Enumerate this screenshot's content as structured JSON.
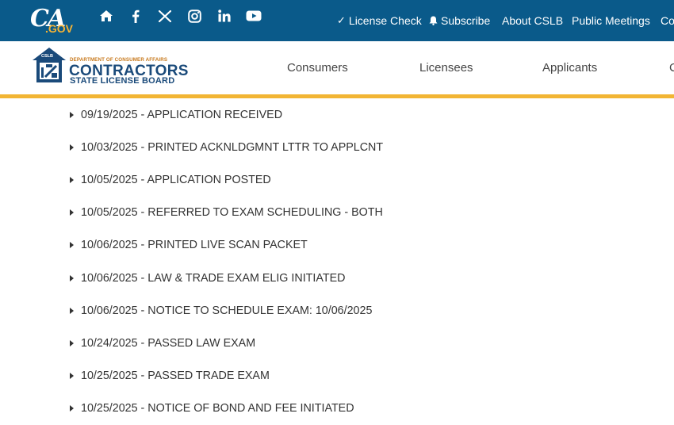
{
  "brand": {
    "ca_text": "CA",
    "gov_text": ".GOV",
    "dept_text": "DEPARTMENT OF CONSUMER AFFAIRS",
    "contractors_text": "CONTRACTORS",
    "board_text": "STATE LICENSE BOARD",
    "badge_text": "CSLB"
  },
  "social_icons": [
    "home-icon",
    "facebook-icon",
    "x-icon",
    "instagram-icon",
    "linkedin-icon",
    "youtube-icon"
  ],
  "topnav": {
    "license_check": "License Check",
    "subscribe": "Subscribe",
    "about": "About CSLB",
    "public_meetings": "Public Meetings",
    "cut_item": "Co"
  },
  "mainnav": {
    "consumers": "Consumers",
    "licensees": "Licensees",
    "applicants": "Applicants",
    "cut_item": "C"
  },
  "colors": {
    "topbar": "#0a5a8a",
    "accent_gold": "#f2b534",
    "brand_navy": "#1a4a7a",
    "text": "#333333"
  },
  "events": [
    "09/19/2025 - APPLICATION RECEIVED",
    "10/03/2025 - PRINTED ACKNLDGMNT LTTR TO APPLCNT",
    "10/05/2025 - APPLICATION POSTED",
    "10/05/2025 - REFERRED TO EXAM SCHEDULING - BOTH",
    "10/06/2025 - PRINTED LIVE SCAN PACKET",
    "10/06/2025 - LAW & TRADE EXAM ELIG INITIATED",
    "10/06/2025 - NOTICE TO SCHEDULE EXAM: 10/06/2025",
    "10/24/2025 - PASSED LAW EXAM",
    "10/25/2025 - PASSED TRADE EXAM",
    "10/25/2025 - NOTICE OF BOND AND FEE INITIATED"
  ]
}
